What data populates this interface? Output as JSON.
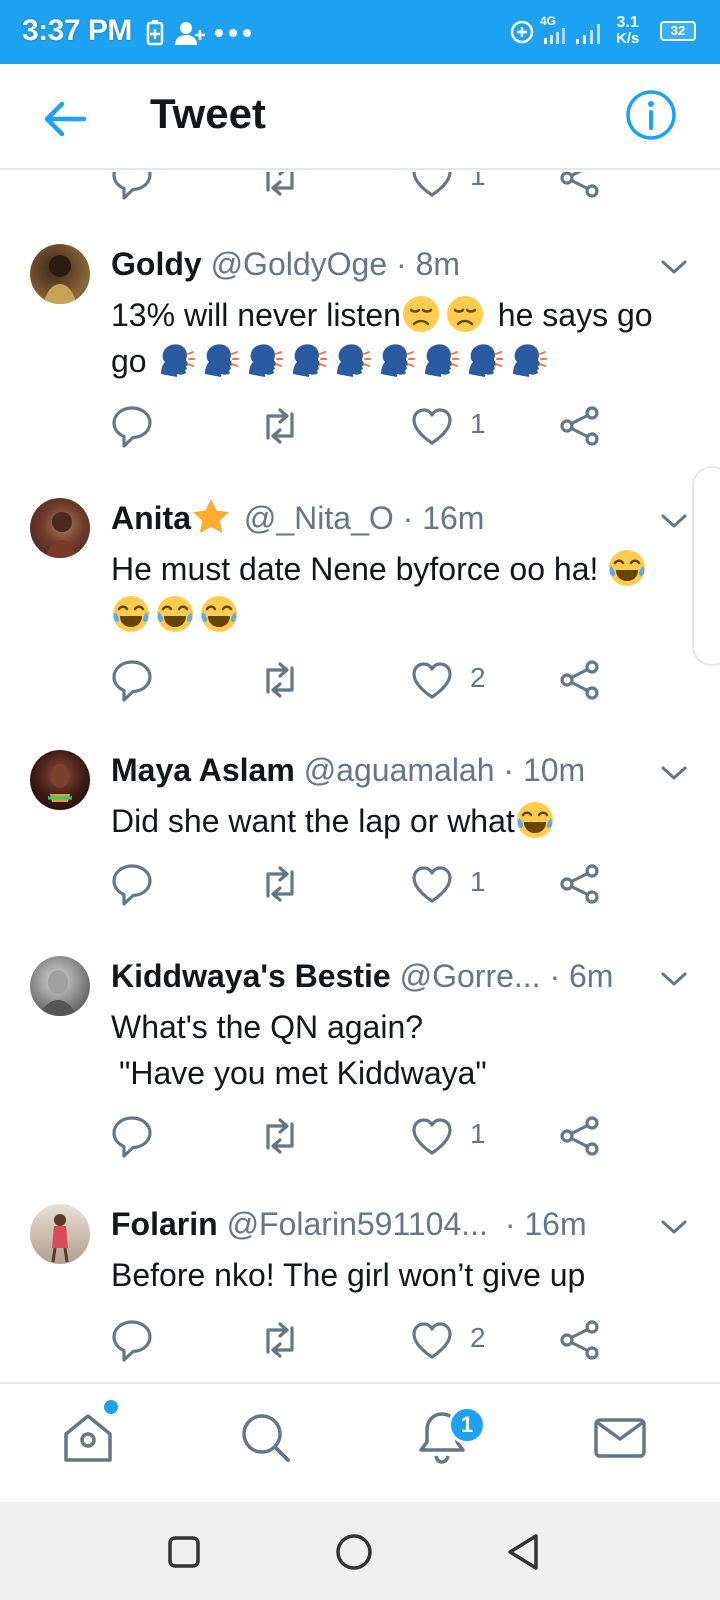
{
  "status_bar": {
    "time": "3:37 PM",
    "network_speed_value": "3.1",
    "network_speed_unit": "K/s",
    "network_type": "4G",
    "battery": "32",
    "icons": [
      "battery-saver-icon",
      "add-contact-icon",
      "more-dots-icon",
      "data-saver-icon",
      "signal-icon",
      "signal-icon-2"
    ]
  },
  "header": {
    "title": "Tweet",
    "back_icon": "back-arrow-icon",
    "info_icon": "info-icon"
  },
  "colors": {
    "accent": "#1da1f2",
    "text_primary": "#14171a",
    "text_secondary": "#657786",
    "divider": "#e1e8ed"
  },
  "partial_tweet": {
    "like_count": "1"
  },
  "tweets": [
    {
      "name": "Goldy",
      "handle": "@GoldyOge",
      "separator": "·",
      "time": "8m",
      "text": "13% will never listen",
      "text_after": " he says go go",
      "emojis_after_text": [
        "disappointed-face",
        "disappointed-face"
      ],
      "emojis_end": [
        "speaking-head",
        "speaking-head",
        "speaking-head",
        "speaking-head",
        "speaking-head",
        "speaking-head",
        "speaking-head",
        "speaking-head",
        "speaking-head"
      ],
      "like_count": "1"
    },
    {
      "name": "Anita",
      "name_badge": "star",
      "handle": "@_Nita_O",
      "separator": "·",
      "time": "16m",
      "text": "He must date Nene byforce oo ha!",
      "emojis_end": [
        "tears-of-joy",
        "tears-of-joy",
        "tears-of-joy",
        "tears-of-joy"
      ],
      "like_count": "2"
    },
    {
      "name": "Maya Aslam",
      "handle": "@aguamalah",
      "separator": "·",
      "time": "10m",
      "text": "Did she want the lap or what",
      "emojis_end": [
        "tears-of-joy"
      ],
      "like_count": "1"
    },
    {
      "name": "Kiddwaya's Bestie",
      "handle": "@Gorre...",
      "separator": "·",
      "time": "6m",
      "text_line1": "What's the QN again?",
      "text_line2": "\"Have you met Kiddwaya\"",
      "like_count": "1"
    },
    {
      "name": "Folarin",
      "handle": "@Folarin591104...",
      "separator": "·",
      "time": "16m",
      "text": "Before nko! The girl won’t give up",
      "like_count": "2"
    }
  ],
  "bottom_nav": {
    "items": [
      "home-icon",
      "search-icon",
      "notifications-icon",
      "messages-icon"
    ],
    "notification_badge": "1"
  },
  "system_nav": {
    "items": [
      "recents-button",
      "home-button",
      "back-button"
    ]
  }
}
